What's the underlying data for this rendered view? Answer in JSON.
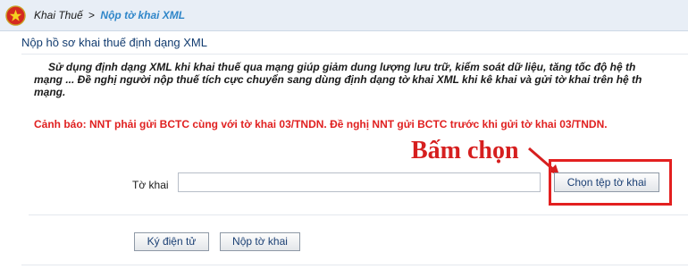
{
  "breadcrumb": {
    "parent": "Khai Thuế",
    "separator": ">",
    "current": "Nộp tờ khai XML"
  },
  "header": {
    "title": "Nộp hồ sơ khai thuế định dạng XML"
  },
  "intro": {
    "line1": "Sử dụng định dạng XML khi khai thuế qua mạng giúp giảm dung lượng lưu trữ, kiểm soát dữ liệu, tăng tốc độ hệ th",
    "line2": "mạng ... Đề nghị người nộp thuế tích cực chuyển sang dùng định dạng tờ khai XML khi kê khai và gửi tờ khai trên hệ th",
    "line3": "mạng."
  },
  "warning": {
    "text": "Cảnh báo: NNT phải gửi BCTC cùng với tờ khai 03/TNDN. Đề nghị NNT gửi BCTC trước khi gửi tờ khai 03/TNDN."
  },
  "annotation": {
    "text": "Bấm chọn"
  },
  "form": {
    "file_label": "Tờ khai",
    "file_value": "",
    "choose_button": "Chọn tệp tờ khai"
  },
  "actions": {
    "sign_button": "Ký điện tử",
    "submit_button": "Nộp tờ khai"
  },
  "colors": {
    "warning": "#e02020",
    "annotation": "#d61f1f",
    "breadcrumb_current": "#2f86c9",
    "header": "#123c70"
  },
  "icons": {
    "logo": "national-emblem-icon"
  }
}
